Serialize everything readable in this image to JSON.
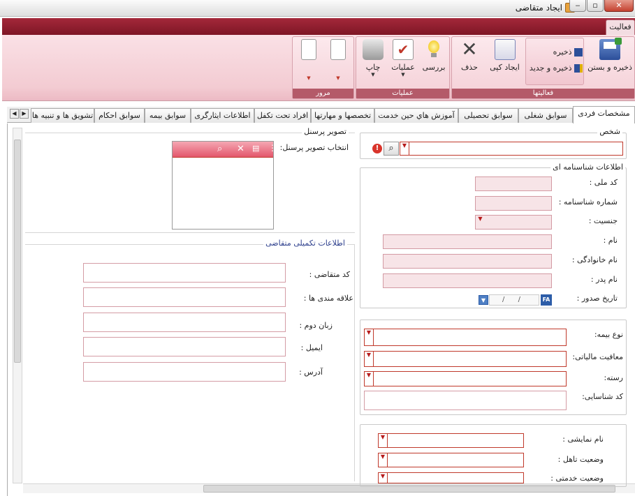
{
  "window": {
    "title": "ایجاد متقاضی"
  },
  "ribbon": {
    "tab": "فعالیت",
    "groups": {
      "activities": {
        "label": "فعالیتها",
        "save_close": "ذخیره و بستن",
        "save": "ذخیره",
        "save_new": "ذخیره و جدید",
        "copy": "ایجاد کپی",
        "delete": "حذف"
      },
      "operations": {
        "label": "عملیات",
        "review": "بررسی",
        "operations": "عملیات",
        "print": "چاپ"
      },
      "browse": {
        "label": "مرور"
      }
    }
  },
  "tabs": [
    "مشخصات فردی",
    "سوابق شغلی",
    "سوابق تحصیلی",
    "آموزش هاي حين خدمت",
    "تخصصها و مهارتها",
    "افراد تحت تکفل",
    "اطلاعات ایثارگری",
    "سوابق بیمه",
    "سوابق احکام",
    "تشویق ها و تنبیه ها"
  ],
  "person": {
    "legend": "شخص"
  },
  "birth_cert": {
    "legend": "اطلاعات شناسنامه ای",
    "national_code": "کد ملی :",
    "cert_number": "شماره شناسنامه :",
    "gender": "جنسیت :",
    "first_name": "نام :",
    "last_name": "نام خانوادگی :",
    "father_name": "نام پدر :",
    "issue_date": "تاریخ صدور :",
    "date_value": "/ /",
    "date_badge": "FA"
  },
  "insurance": {
    "insurance_type": "نوع بیمه:",
    "tax_exemption": "معافیت مالیاتی:",
    "category": "رسته:",
    "id_code": "کد شناسایی:"
  },
  "misc": {
    "display_name": "نام نمایشی :",
    "marital_status": "وضعیت تاهل :",
    "service_status": "وضعیت خدمتی :"
  },
  "photo": {
    "legend": "تصویر پرسنل",
    "select_label": "انتخاب تصویر پرسنل:"
  },
  "extra": {
    "legend": "اطلاعات تکمیلی متقاضی",
    "applicant_code": "کد متقاضی :",
    "interests": "علاقه مندی ها :",
    "second_language": "زبان دوم :",
    "email": "ایمیل :",
    "address": "آدرس :"
  },
  "colors": {
    "ribbon": "#8b1a2b",
    "field_border": "#c0392b"
  }
}
